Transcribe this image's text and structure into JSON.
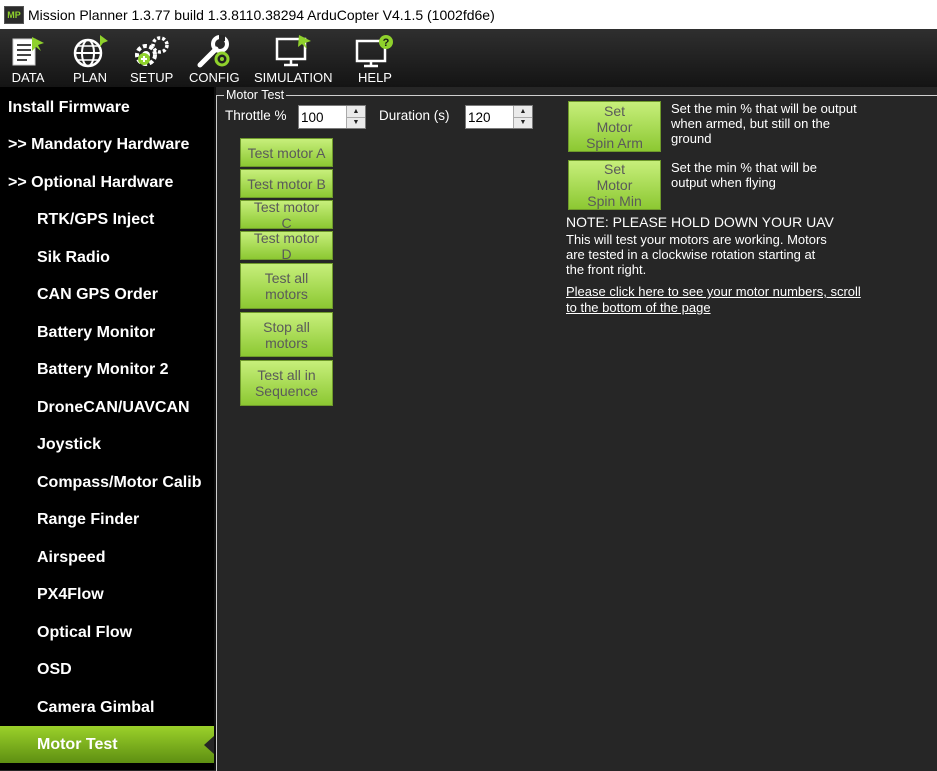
{
  "window": {
    "title": "Mission Planner 1.3.77 build 1.3.8110.38294 ArduCopter V4.1.5 (1002fd6e)",
    "icon_text": "MP"
  },
  "toolbar": {
    "items": [
      {
        "label": "DATA",
        "icon": "data-icon"
      },
      {
        "label": "PLAN",
        "icon": "globe-icon"
      },
      {
        "label": "SETUP",
        "icon": "gears-icon"
      },
      {
        "label": "CONFIG",
        "icon": "wrench-icon"
      },
      {
        "label": "SIMULATION",
        "icon": "monitor-plane-icon"
      },
      {
        "label": "HELP",
        "icon": "monitor-help-icon"
      }
    ]
  },
  "sidebar": {
    "items": [
      {
        "label": "Install Firmware"
      },
      {
        "label": ">> Mandatory Hardware"
      },
      {
        "label": ">> Optional Hardware"
      },
      {
        "label": "RTK/GPS Inject"
      },
      {
        "label": "Sik Radio"
      },
      {
        "label": "CAN GPS Order"
      },
      {
        "label": "Battery Monitor"
      },
      {
        "label": "Battery Monitor 2"
      },
      {
        "label": "DroneCAN/UAVCAN"
      },
      {
        "label": "Joystick"
      },
      {
        "label": "Compass/Motor Calib"
      },
      {
        "label": "Range Finder"
      },
      {
        "label": "Airspeed"
      },
      {
        "label": "PX4Flow"
      },
      {
        "label": "Optical Flow"
      },
      {
        "label": "OSD"
      },
      {
        "label": "Camera Gimbal"
      },
      {
        "label": "Motor Test"
      }
    ],
    "active": "Motor Test"
  },
  "motor_test": {
    "group_title": "Motor Test",
    "throttle_label": "Throttle %",
    "throttle_value": "100",
    "duration_label": "Duration (s)",
    "duration_value": "120",
    "buttons": {
      "test_a": "Test motor A",
      "test_b": "Test motor B",
      "test_c": "Test motor C",
      "test_d": "Test motor D",
      "test_all": "Test all motors",
      "stop_all": "Stop all motors",
      "test_seq": "Test all in Sequence",
      "spin_arm": "Set Motor Spin Arm",
      "spin_min": "Set Motor Spin Min"
    },
    "spin_arm_desc": "Set the min % that will be output when armed, but still on the ground",
    "spin_min_desc": "Set the min % that will be output when flying",
    "note_title": "NOTE: PLEASE HOLD DOWN YOUR UAV",
    "note_body": "This will test your motors are working. Motors are tested in a clockwise rotation starting at the front right.",
    "link_text": "Please click here to see your motor numbers, scroll to the bottom of the page"
  },
  "colors": {
    "accent_green": "#8cc832",
    "sidebar_bg": "#000000",
    "content_bg": "#262626"
  }
}
